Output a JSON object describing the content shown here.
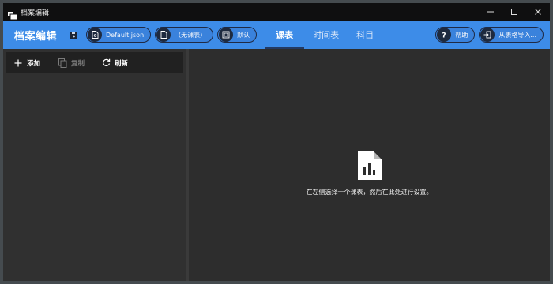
{
  "window": {
    "title": "档案编辑"
  },
  "header": {
    "title": "档案编辑",
    "pills": [
      {
        "label": "Default.json",
        "icon": "file-json-icon"
      },
      {
        "label": "（无课表）",
        "icon": "file-icon"
      },
      {
        "label": "默认",
        "icon": "layout-icon"
      }
    ],
    "tabs": [
      {
        "label": "课表",
        "active": true
      },
      {
        "label": "时间表",
        "active": false
      },
      {
        "label": "科目",
        "active": false
      }
    ],
    "help_label": "帮助",
    "import_label": "从表格导入..."
  },
  "toolbar": {
    "add_label": "添加",
    "copy_label": "复制",
    "refresh_label": "刷新"
  },
  "main": {
    "empty_message": "在左侧选择一个课表，然后在此处进行设置。"
  },
  "colors": {
    "accent": "#3d8ce8",
    "background": "#2d2d2d",
    "titlebar": "#0f0f10"
  }
}
